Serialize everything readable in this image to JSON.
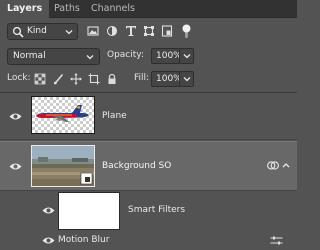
{
  "tabs": [
    {
      "label": "Layers",
      "active": true
    },
    {
      "label": "Paths",
      "active": false
    },
    {
      "label": "Channels",
      "active": false
    }
  ],
  "filter": {
    "kind_label": "Kind",
    "icons": [
      "pixel-filter-icon",
      "adjustment-filter-icon",
      "type-filter-icon",
      "shape-filter-icon",
      "smart-object-filter-icon"
    ]
  },
  "blend": {
    "mode": "Normal",
    "opacity_label": "Opacity:",
    "opacity_value": "100%"
  },
  "lock": {
    "label": "Lock:",
    "fill_label": "Fill:",
    "fill_value": "100%"
  },
  "layers": [
    {
      "name": "Plane",
      "visible": true,
      "selected": false
    },
    {
      "name": "Background SO",
      "visible": true,
      "selected": true
    },
    {
      "name": "Smart Filters",
      "visible": true,
      "selected": false
    },
    {
      "name": "Motion Blur",
      "visible": true,
      "selected": false
    }
  ],
  "colors": {
    "panel": "#535353",
    "selected_row": "#686868",
    "tabbar": "#323232",
    "plane_livery": "#c8102e"
  }
}
